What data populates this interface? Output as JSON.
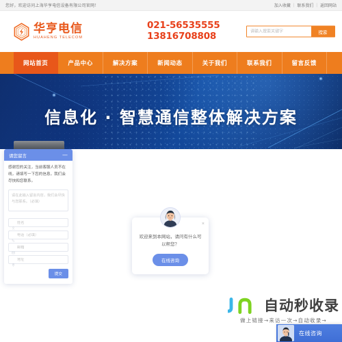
{
  "topbar": {
    "welcome": "您好，欢迎访问上海华亨电信设备有限公司官网！",
    "links": [
      "加入收藏",
      "联系我们",
      "返回网站"
    ],
    "separator": "|"
  },
  "header": {
    "logo_cn": "华亨电信",
    "logo_en": "HUAHENG TELECOM",
    "phone_primary": "021-56535555",
    "phone_secondary": "13816708808",
    "search_placeholder": "请输入搜索关键字",
    "search_value": "",
    "search_button": "搜索"
  },
  "nav": {
    "items": [
      {
        "label": "网站首页",
        "active": true
      },
      {
        "label": "产品中心",
        "active": false
      },
      {
        "label": "解决方案",
        "active": false
      },
      {
        "label": "新闻动态",
        "active": false
      },
      {
        "label": "关于我们",
        "active": false
      },
      {
        "label": "联系我们",
        "active": false
      },
      {
        "label": "留言反馈",
        "active": false
      }
    ]
  },
  "banner": {
    "headline": "信息化 · 智慧通信整体解决方案"
  },
  "greeting": {
    "close_label": "×",
    "message": "欢迎来到本网站，请问有什么可以帮您？",
    "button_label": "在线咨询"
  },
  "message_form": {
    "title": "请您留言",
    "minimize_label": "—",
    "intro": "感谢您的关注，当前客服人员不在线，请填写一下您的信息，我们会尽快和您联系。",
    "content_placeholder": "请在此输入留言内容，我们会尽快与您联系。（必填）",
    "content_value": "",
    "fields": [
      {
        "icon": "user-icon",
        "placeholder": "姓名",
        "value": ""
      },
      {
        "icon": "phone-icon",
        "placeholder": "电话（必填）",
        "value": ""
      },
      {
        "icon": "mail-icon",
        "placeholder": "邮箱",
        "value": ""
      },
      {
        "icon": "location-icon",
        "placeholder": "地址",
        "value": ""
      }
    ],
    "submit_label": "提交"
  },
  "watermark": {
    "brand": "自动秒收录",
    "tagline": "做上链接→来访一次→自动收录→"
  },
  "consult_widget": {
    "label": "在线咨询"
  },
  "colors": {
    "orange": "#ee7d1e",
    "orange_active": "#e8571a",
    "logo_orange": "#e8571a",
    "phone_red": "#e8401a",
    "blue_accent": "#6b8fe8",
    "banner_blue": "#14428f"
  }
}
